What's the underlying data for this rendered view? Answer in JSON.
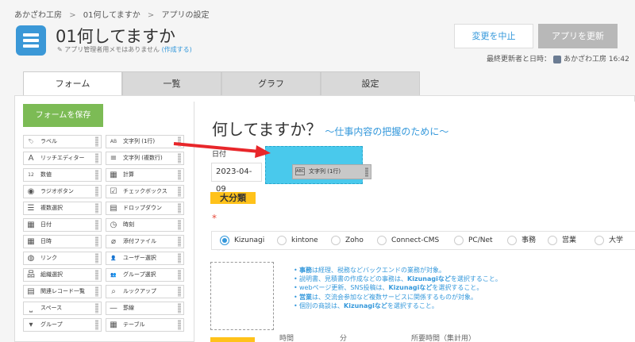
{
  "breadcrumb": [
    {
      "label": "あかざわ工房"
    },
    {
      "label": "01何してますか"
    },
    {
      "label": "アプリの設定"
    }
  ],
  "breadcrumb_sep": ">",
  "app": {
    "title": "01何してますか",
    "memo_text": "アプリ管理者用メモはありません",
    "memo_link": "(作成する)"
  },
  "actions": {
    "cancel_label": "変更を中止",
    "update_label": "アプリを更新"
  },
  "last_update": {
    "label": "最終更新者と日時：",
    "user": "あかざわ工房",
    "time": "16:42"
  },
  "tabs": [
    {
      "label": "フォーム",
      "active": true
    },
    {
      "label": "一覧",
      "active": false
    },
    {
      "label": "グラフ",
      "active": false
    },
    {
      "label": "設定",
      "active": false
    }
  ],
  "form": {
    "save_label": "フォームを保存"
  },
  "palette": {
    "left": [
      {
        "label": "ラベル",
        "icon": "tag-icon"
      },
      {
        "label": "リッチエディター",
        "icon": "rich-editor-icon"
      },
      {
        "label": "数値",
        "icon": "number-icon"
      },
      {
        "label": "ラジオボタン",
        "icon": "radio-icon"
      },
      {
        "label": "複数選択",
        "icon": "multi-select-icon"
      },
      {
        "label": "日付",
        "icon": "calendar-icon"
      },
      {
        "label": "日時",
        "icon": "datetime-icon"
      },
      {
        "label": "リンク",
        "icon": "globe-icon"
      },
      {
        "label": "組織選択",
        "icon": "org-icon"
      },
      {
        "label": "関連レコード一覧",
        "icon": "related-records-icon"
      },
      {
        "label": "スペース",
        "icon": "space-icon"
      },
      {
        "label": "グループ",
        "icon": "group-icon"
      }
    ],
    "right": [
      {
        "label": "文字列 (1行)",
        "icon": "text-single-icon"
      },
      {
        "label": "文字列 (複数行)",
        "icon": "text-multi-icon"
      },
      {
        "label": "計算",
        "icon": "calculator-icon"
      },
      {
        "label": "チェックボックス",
        "icon": "checkbox-icon"
      },
      {
        "label": "ドロップダウン",
        "icon": "dropdown-icon"
      },
      {
        "label": "時刻",
        "icon": "clock-icon"
      },
      {
        "label": "添付ファイル",
        "icon": "paperclip-icon"
      },
      {
        "label": "ユーザー選択",
        "icon": "user-icon"
      },
      {
        "label": "グループ選択",
        "icon": "user-group-icon"
      },
      {
        "label": "ルックアップ",
        "icon": "lookup-icon"
      },
      {
        "label": "罫線",
        "icon": "divider-line-icon"
      },
      {
        "label": "テーブル",
        "icon": "table-icon"
      }
    ]
  },
  "canvas": {
    "heading_main": "何してますか？",
    "heading_sub": "〜仕事内容の把握のために〜",
    "date_label": "日付",
    "date_value": "2023-04-09",
    "drag_chip_label": "文字列 (1行)",
    "drag_chip_icon": "ABC",
    "category_label": "大分類",
    "required_mark": "*",
    "radio_options": [
      {
        "label": "Kizunagi",
        "checked": true
      },
      {
        "label": "kintone",
        "checked": false
      },
      {
        "label": "Zoho",
        "checked": false
      },
      {
        "label": "Connect-CMS",
        "checked": false
      },
      {
        "label": "PC/Net",
        "checked": false
      },
      {
        "label": "事務",
        "checked": false
      },
      {
        "label": "営業",
        "checked": false
      },
      {
        "label": "大学",
        "checked": false
      }
    ],
    "notes": [
      {
        "bold": "事務",
        "text": "は経理、税務などバックエンドの業務が対象。"
      },
      {
        "bold": "",
        "text": "説明書、見積書の作成などの事務は、",
        "bold2": "Kizunagiなど",
        "text2": "を選択すること。"
      },
      {
        "bold": "",
        "text": "webページ更新、SNS投稿は、",
        "bold2": "Kizunagiなど",
        "text2": "を選択すること。"
      },
      {
        "bold": "営業",
        "text": "は、交流会参加など複数サービスに関係するものが対象。"
      },
      {
        "bold": "",
        "text": "個別の商談は、",
        "bold2": "Kizunagiなど",
        "text2": "を選択すること。"
      }
    ],
    "bottom_texts": [
      "時間",
      "分",
      "所要時間（集計用）"
    ]
  },
  "colors": {
    "accent_blue": "#3498db",
    "save_green": "#7cbb55",
    "drop_zone": "#49c9ec",
    "label_yellow": "#ffc21a",
    "arrow_red": "#e8262a"
  }
}
